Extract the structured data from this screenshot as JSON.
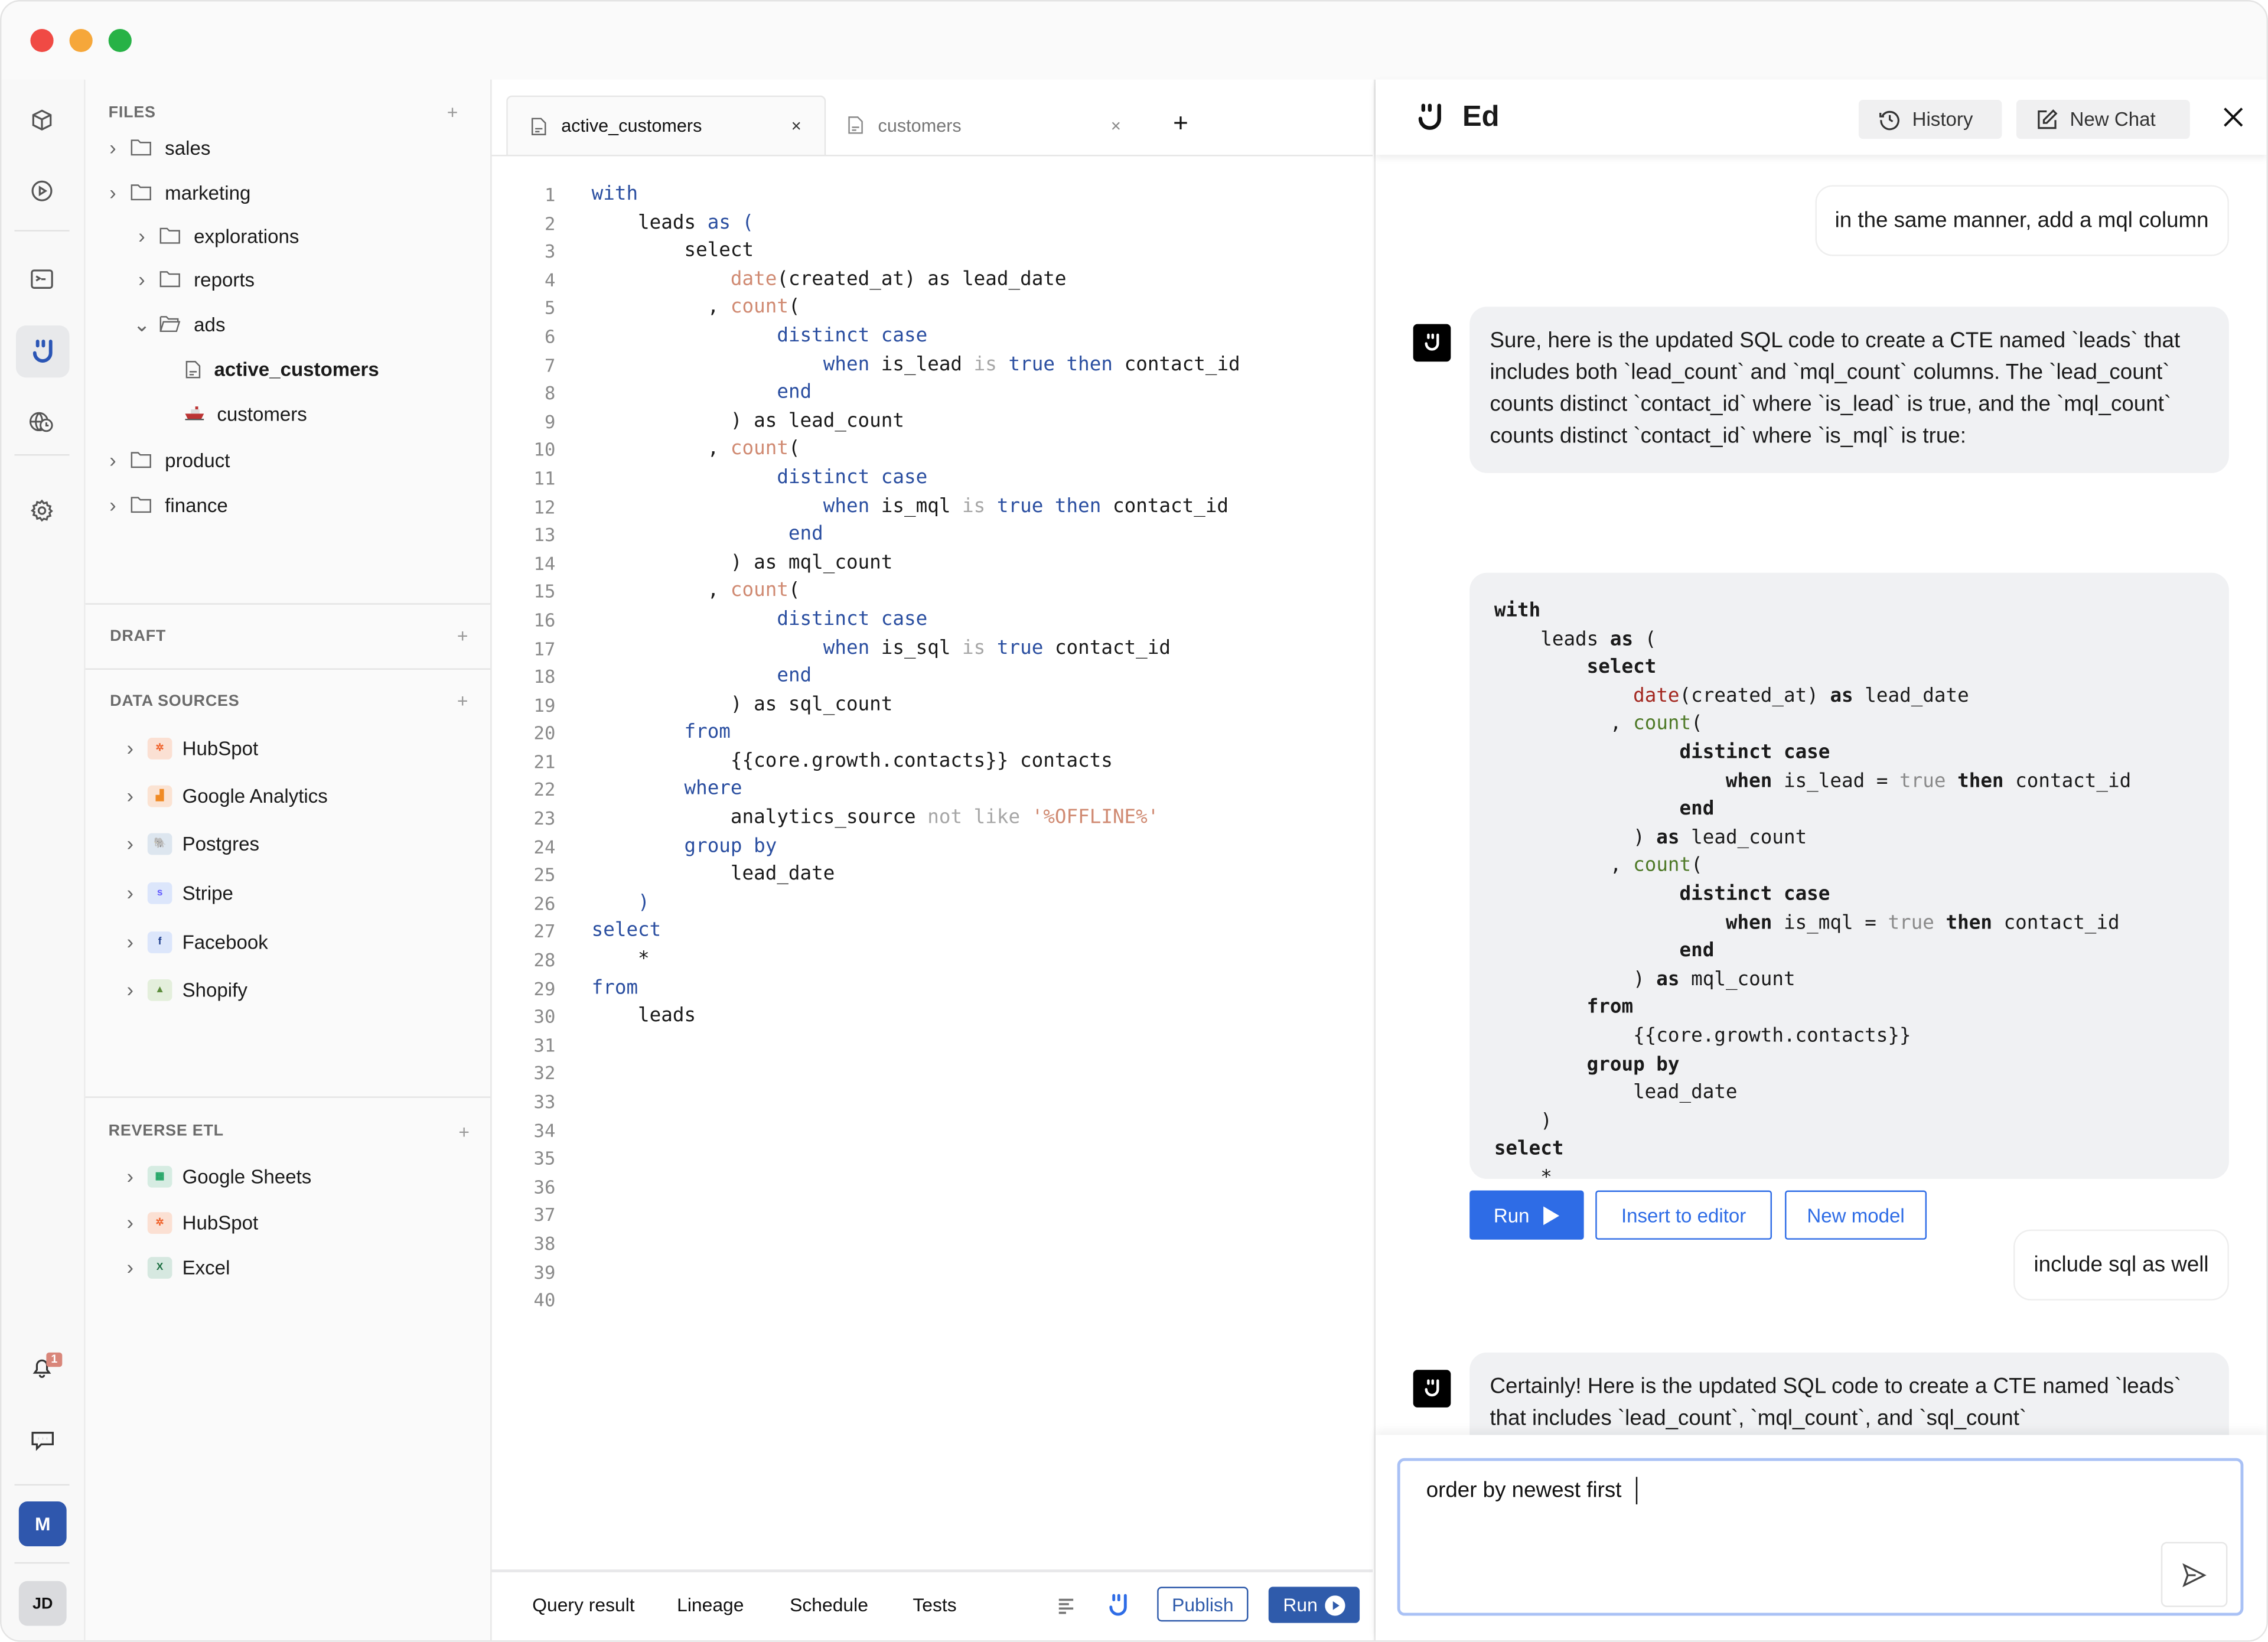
{
  "window": {
    "controls": [
      "close",
      "minimize",
      "maximize"
    ],
    "colors": {
      "close": "#f04a44",
      "minimize": "#f6a73a",
      "maximize": "#27b246",
      "accent": "#2f5bab",
      "run_blue": "#2e6ce6"
    }
  },
  "rail": {
    "top_icons": [
      "cube-icon",
      "play-circle-icon",
      "terminal-icon",
      "ed-smiley-icon",
      "globe-clock-icon",
      "gear-icon"
    ],
    "notification_count": "1",
    "workspace_initial": "M",
    "user_initials": "JD"
  },
  "sidebar": {
    "files": {
      "title": "FILES",
      "items": [
        {
          "label": "sales",
          "type": "folder",
          "level": 0,
          "expanded": false
        },
        {
          "label": "marketing",
          "type": "folder",
          "level": 0,
          "expanded": false
        },
        {
          "label": "explorations",
          "type": "folder",
          "level": 1,
          "expanded": false
        },
        {
          "label": "reports",
          "type": "folder",
          "level": 1,
          "expanded": false
        },
        {
          "label": "ads",
          "type": "folder",
          "level": 1,
          "expanded": true
        },
        {
          "label": "active_customers",
          "type": "file",
          "level": 2,
          "active": true
        },
        {
          "label": "customers",
          "type": "ship",
          "level": 2
        },
        {
          "label": "product",
          "type": "folder",
          "level": 0,
          "expanded": false
        },
        {
          "label": "finance",
          "type": "folder",
          "level": 0,
          "expanded": false
        }
      ]
    },
    "draft": {
      "title": "DRAFT"
    },
    "data_sources": {
      "title": "DATA SOURCES",
      "items": [
        {
          "label": "HubSpot",
          "glyph": "✲",
          "bg": "#fbe0d3",
          "fg": "#f0652f"
        },
        {
          "label": "Google Analytics",
          "glyph": "▟",
          "bg": "#fbe3d3",
          "fg": "#f08a24"
        },
        {
          "label": "Postgres",
          "glyph": "🐘",
          "bg": "#dde6ef",
          "fg": "#336791"
        },
        {
          "label": "Stripe",
          "glyph": "s",
          "bg": "#dce6fb",
          "fg": "#635bff"
        },
        {
          "label": "Facebook",
          "glyph": "f",
          "bg": "#dce6fb",
          "fg": "#1b3a8a"
        },
        {
          "label": "Shopify",
          "glyph": "▲",
          "bg": "#e4efdc",
          "fg": "#5e8e3e"
        }
      ]
    },
    "reverse_etl": {
      "title": "REVERSE ETL",
      "items": [
        {
          "label": "Google Sheets",
          "glyph": "▦",
          "bg": "#d6ece2",
          "fg": "#1ea362"
        },
        {
          "label": "HubSpot",
          "glyph": "✲",
          "bg": "#fbe0d3",
          "fg": "#f0652f"
        },
        {
          "label": "Excel",
          "glyph": "X",
          "bg": "#d6e8e0",
          "fg": "#1d6f42"
        }
      ]
    }
  },
  "editor": {
    "tabs": [
      {
        "label": "active_customers",
        "active": true
      },
      {
        "label": "customers",
        "active": false
      }
    ],
    "line_count": 40,
    "lines": [
      [
        [
          "with",
          "kw"
        ]
      ],
      [
        [
          "    leads ",
          "pl"
        ],
        [
          "as (",
          "kw"
        ]
      ],
      [
        [
          "        select",
          "pl"
        ]
      ],
      [
        [
          "            ",
          "pl"
        ],
        [
          "date",
          "fn"
        ],
        [
          "(created_at) as lead_date",
          "pl"
        ]
      ],
      [
        [
          "          , ",
          "pl"
        ],
        [
          "count",
          "fn"
        ],
        [
          "(",
          "pl"
        ]
      ],
      [
        [
          "                ",
          "pl"
        ],
        [
          "distinct case",
          "kw"
        ]
      ],
      [
        [
          "                    ",
          "pl"
        ],
        [
          "when",
          "kw"
        ],
        [
          " is_lead ",
          "pl"
        ],
        [
          "is",
          "op"
        ],
        [
          " ",
          "pl"
        ],
        [
          "true then",
          "kw"
        ],
        [
          " contact_id",
          "pl"
        ]
      ],
      [
        [
          "                ",
          "pl"
        ],
        [
          "end",
          "kw"
        ]
      ],
      [
        [
          "            ) as lead_count",
          "pl"
        ]
      ],
      [
        [
          "          , ",
          "pl"
        ],
        [
          "count",
          "fn"
        ],
        [
          "(",
          "pl"
        ]
      ],
      [
        [
          "                ",
          "pl"
        ],
        [
          "distinct case",
          "kw"
        ]
      ],
      [
        [
          "                    ",
          "pl"
        ],
        [
          "when",
          "kw"
        ],
        [
          " is_mql ",
          "pl"
        ],
        [
          "is",
          "op"
        ],
        [
          " ",
          "pl"
        ],
        [
          "true then",
          "kw"
        ],
        [
          " contact_id",
          "pl"
        ]
      ],
      [
        [
          "                 ",
          "pl"
        ],
        [
          "end",
          "kw"
        ]
      ],
      [
        [
          "            ) as mql_count",
          "pl"
        ]
      ],
      [
        [
          "          , ",
          "pl"
        ],
        [
          "count",
          "fn"
        ],
        [
          "(",
          "pl"
        ]
      ],
      [
        [
          "                ",
          "pl"
        ],
        [
          "distinct case",
          "kw"
        ]
      ],
      [
        [
          "                    ",
          "pl"
        ],
        [
          "when",
          "kw"
        ],
        [
          " is_sql ",
          "pl"
        ],
        [
          "is",
          "op"
        ],
        [
          " ",
          "pl"
        ],
        [
          "true",
          "kw"
        ],
        [
          " contact_id",
          "pl"
        ]
      ],
      [
        [
          "                ",
          "pl"
        ],
        [
          "end",
          "kw"
        ]
      ],
      [
        [
          "            ) as sql_count",
          "pl"
        ]
      ],
      [
        [
          "        ",
          "pl"
        ],
        [
          "from",
          "kw"
        ]
      ],
      [
        [
          "            {{core.growth.contacts}} contacts",
          "pl"
        ]
      ],
      [
        [
          "        ",
          "pl"
        ],
        [
          "where",
          "kw"
        ]
      ],
      [
        [
          "            analytics_source ",
          "pl"
        ],
        [
          "not like",
          "op"
        ],
        [
          " ",
          "pl"
        ],
        [
          "'%OFFLINE%'",
          "str"
        ]
      ],
      [
        [
          "        ",
          "pl"
        ],
        [
          "group by",
          "kw"
        ]
      ],
      [
        [
          "            lead_date",
          "pl"
        ]
      ],
      [
        [
          "    ",
          "pl"
        ],
        [
          ")",
          "kw"
        ]
      ],
      [
        [
          "select",
          "kw"
        ]
      ],
      [
        [
          "    *",
          "pl"
        ]
      ],
      [
        [
          "from",
          "kw"
        ]
      ],
      [
        [
          "    leads",
          "pl"
        ]
      ]
    ],
    "bottom_tabs": [
      "Query result",
      "Lineage",
      "Schedule",
      "Tests"
    ],
    "publish_label": "Publish",
    "run_label": "Run"
  },
  "chat": {
    "title": "Ed",
    "history_label": "History",
    "new_chat_label": "New Chat",
    "messages": [
      {
        "role": "user",
        "text": "in the same manner, add a mql column"
      },
      {
        "role": "assistant",
        "text": "Sure, here is the updated SQL code to create a CTE named `leads` that includes both `lead_count` and `mql_count` columns. The `lead_count` counts distinct `contact_id` where `is_lead` is true, and the `mql_count` counts distinct `contact_id` where `is_mql` is true:"
      },
      {
        "role": "user",
        "text": "include sql as well"
      },
      {
        "role": "assistant",
        "text": "Certainly! Here is the updated SQL code to create a CTE named `leads` that includes `lead_count`, `mql_count`, and `sql_count`"
      }
    ],
    "code_block": [
      [
        [
          "with",
          "b"
        ]
      ],
      [
        [
          "    leads ",
          "pl"
        ],
        [
          "as",
          "b"
        ],
        [
          " (",
          "pl"
        ]
      ],
      [
        [
          "        ",
          "pl"
        ],
        [
          "select",
          "b"
        ]
      ],
      [
        [
          "            ",
          "pl"
        ],
        [
          "date",
          "rd"
        ],
        [
          "(created_at) ",
          "pl"
        ],
        [
          "as",
          "b"
        ],
        [
          " lead_date",
          "pl"
        ]
      ],
      [
        [
          "          , ",
          "pl"
        ],
        [
          "count",
          "gr"
        ],
        [
          "(",
          "pl"
        ]
      ],
      [
        [
          "                ",
          "pl"
        ],
        [
          "distinct case",
          "b"
        ]
      ],
      [
        [
          "                    ",
          "pl"
        ],
        [
          "when",
          "b"
        ],
        [
          " is_lead = ",
          "pl"
        ],
        [
          "true",
          "gy"
        ],
        [
          " ",
          "pl"
        ],
        [
          "then",
          "b"
        ],
        [
          " contact_id",
          "pl"
        ]
      ],
      [
        [
          "                ",
          "pl"
        ],
        [
          "end",
          "b"
        ]
      ],
      [
        [
          "            ) ",
          "pl"
        ],
        [
          "as",
          "b"
        ],
        [
          " lead_count",
          "pl"
        ]
      ],
      [
        [
          "          , ",
          "pl"
        ],
        [
          "count",
          "gr"
        ],
        [
          "(",
          "pl"
        ]
      ],
      [
        [
          "                ",
          "pl"
        ],
        [
          "distinct case",
          "b"
        ]
      ],
      [
        [
          "                    ",
          "pl"
        ],
        [
          "when",
          "b"
        ],
        [
          " is_mql = ",
          "pl"
        ],
        [
          "true",
          "gy"
        ],
        [
          " ",
          "pl"
        ],
        [
          "then",
          "b"
        ],
        [
          " contact_id",
          "pl"
        ]
      ],
      [
        [
          "                ",
          "pl"
        ],
        [
          "end",
          "b"
        ]
      ],
      [
        [
          "            ) ",
          "pl"
        ],
        [
          "as",
          "b"
        ],
        [
          " mql_count",
          "pl"
        ]
      ],
      [
        [
          "        ",
          "pl"
        ],
        [
          "from",
          "b"
        ]
      ],
      [
        [
          "            {{core.growth.contacts}}",
          "pl"
        ]
      ],
      [
        [
          "        ",
          "pl"
        ],
        [
          "group by",
          "b"
        ]
      ],
      [
        [
          "            lead_date",
          "pl"
        ]
      ],
      [
        [
          "    )",
          "pl"
        ]
      ],
      [
        [
          "select",
          "b"
        ]
      ],
      [
        [
          "    *",
          "pl"
        ]
      ]
    ],
    "actions": {
      "run": "Run",
      "insert": "Insert to editor",
      "new_model": "New model"
    },
    "input_value": "order by newest first"
  }
}
